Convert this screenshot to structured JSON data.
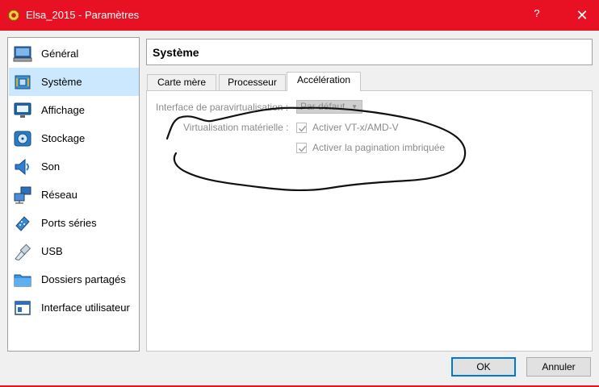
{
  "window": {
    "title": "Elsa_2015 - Paramètres",
    "help_label": "?",
    "close_label": "✕",
    "accent_color": "#e81123"
  },
  "sidebar": {
    "items": [
      {
        "label": "Général",
        "icon": "monitor-icon"
      },
      {
        "label": "Système",
        "icon": "motherboard-chip-icon",
        "selected": true
      },
      {
        "label": "Affichage",
        "icon": "display-icon"
      },
      {
        "label": "Stockage",
        "icon": "disk-icon"
      },
      {
        "label": "Son",
        "icon": "speaker-icon"
      },
      {
        "label": "Réseau",
        "icon": "network-icon"
      },
      {
        "label": "Ports séries",
        "icon": "serial-port-icon"
      },
      {
        "label": "USB",
        "icon": "usb-plug-icon"
      },
      {
        "label": "Dossiers partagés",
        "icon": "folder-icon"
      },
      {
        "label": "Interface utilisateur",
        "icon": "window-ui-icon"
      }
    ]
  },
  "main": {
    "section_title": "Système",
    "tabs": [
      {
        "label": "Carte mère"
      },
      {
        "label": "Processeur"
      },
      {
        "label": "Accélération",
        "active": true
      }
    ],
    "acceleration": {
      "paravirt_label": "Interface de paravirtualisation :",
      "paravirt_value": "Par défaut",
      "hwvirt_label": "Virtualisation matérielle :",
      "vtx_label": "Activer VT-x/AMD-V",
      "vtx_checked": true,
      "nested_paging_label": "Activer la pagination imbriquée",
      "nested_paging_checked": true
    }
  },
  "footer": {
    "ok_label": "OK",
    "cancel_label": "Annuler"
  }
}
